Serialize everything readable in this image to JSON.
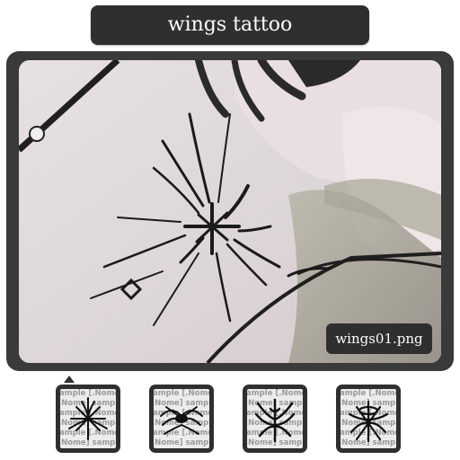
{
  "header": {
    "title": "wings tattoo"
  },
  "preview": {
    "filename": "wings01.png",
    "image_icon": "tattoo-preview-icon"
  },
  "gallery": {
    "watermark_lines": [
      "sample [.Nome] sample",
      "[.Nome] sample [.Nome]"
    ],
    "items": [
      {
        "icon": "wings-design-1-icon",
        "selected": true
      },
      {
        "icon": "wings-design-2-icon",
        "selected": false
      },
      {
        "icon": "wings-design-3-icon",
        "selected": false
      },
      {
        "icon": "wings-design-4-icon",
        "selected": false
      }
    ]
  },
  "colors": {
    "panel": "#2f2f2f",
    "frame": "#3a3a3a",
    "ink": "#1a1a1a"
  }
}
